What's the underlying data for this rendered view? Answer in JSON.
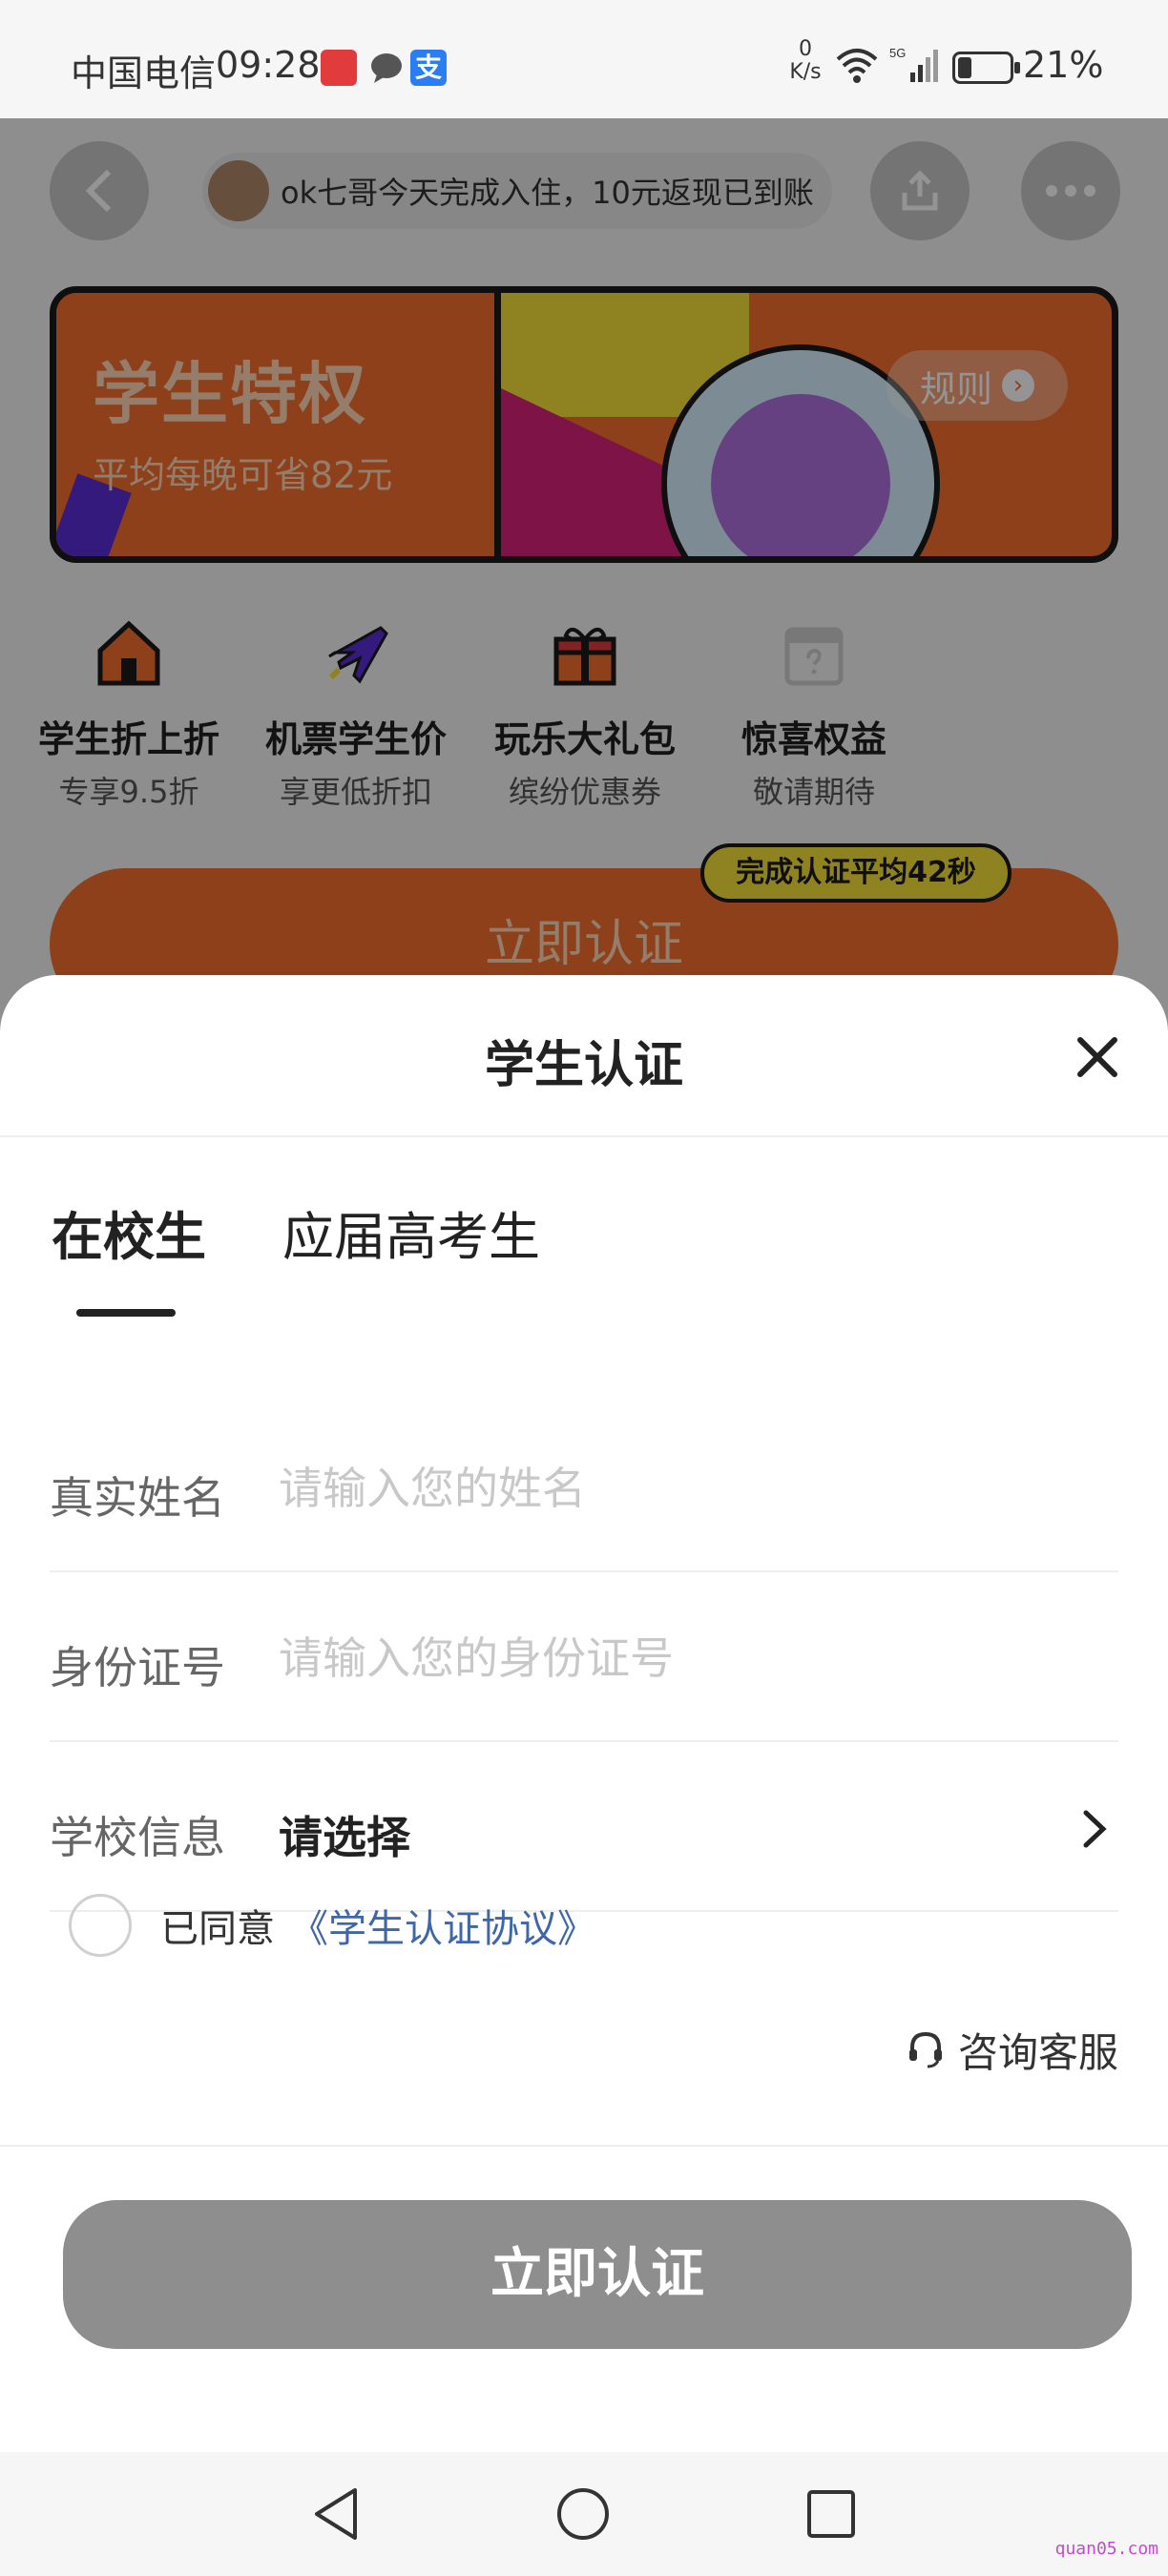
{
  "status_bar": {
    "carrier": "中国电信",
    "time": "09:28",
    "app_badge_alipay": "支",
    "net_speed_value": "0",
    "net_speed_unit": "K/s",
    "network_type": "5G",
    "battery_percent": "21%",
    "battery_level": 0.21
  },
  "background_page": {
    "notice_text": "ok七哥今天完成入住，10元返现已到账",
    "banner": {
      "title": "学生特权",
      "subtitle": "平均每晚可省82元",
      "rules_label": "规则"
    },
    "perks": [
      {
        "title": "学生折上折",
        "subtitle": "专享9.5折",
        "icon": "house-icon"
      },
      {
        "title": "机票学生价",
        "subtitle": "享更低折扣",
        "icon": "airplane-icon"
      },
      {
        "title": "玩乐大礼包",
        "subtitle": "缤纷优惠券",
        "icon": "gift-icon"
      },
      {
        "title": "惊喜权益",
        "subtitle": "敬请期待",
        "icon": "calendar-icon"
      }
    ],
    "cta_label": "立即认证",
    "cta_badge": "完成认证平均42秒"
  },
  "sheet": {
    "title": "学生认证",
    "tabs": [
      {
        "label": "在校生",
        "active": true
      },
      {
        "label": "应届高考生",
        "active": false
      }
    ],
    "fields": {
      "name": {
        "label": "真实姓名",
        "placeholder": "请输入您的姓名",
        "value": ""
      },
      "id_number": {
        "label": "身份证号",
        "placeholder": "请输入您的身份证号",
        "value": ""
      },
      "school": {
        "label": "学校信息",
        "value": "请选择"
      }
    },
    "agreement": {
      "prefix": "已同意",
      "link": "《学生认证协议》",
      "checked": false
    },
    "support_label": "咨询客服",
    "submit_label": "立即认证"
  },
  "watermark": "quan05.com",
  "colors": {
    "brand_orange": "#f46f2d",
    "badge_yellow": "#f6e23a",
    "link_blue": "#3f66a8",
    "disabled_button": "#8e8e8e"
  }
}
